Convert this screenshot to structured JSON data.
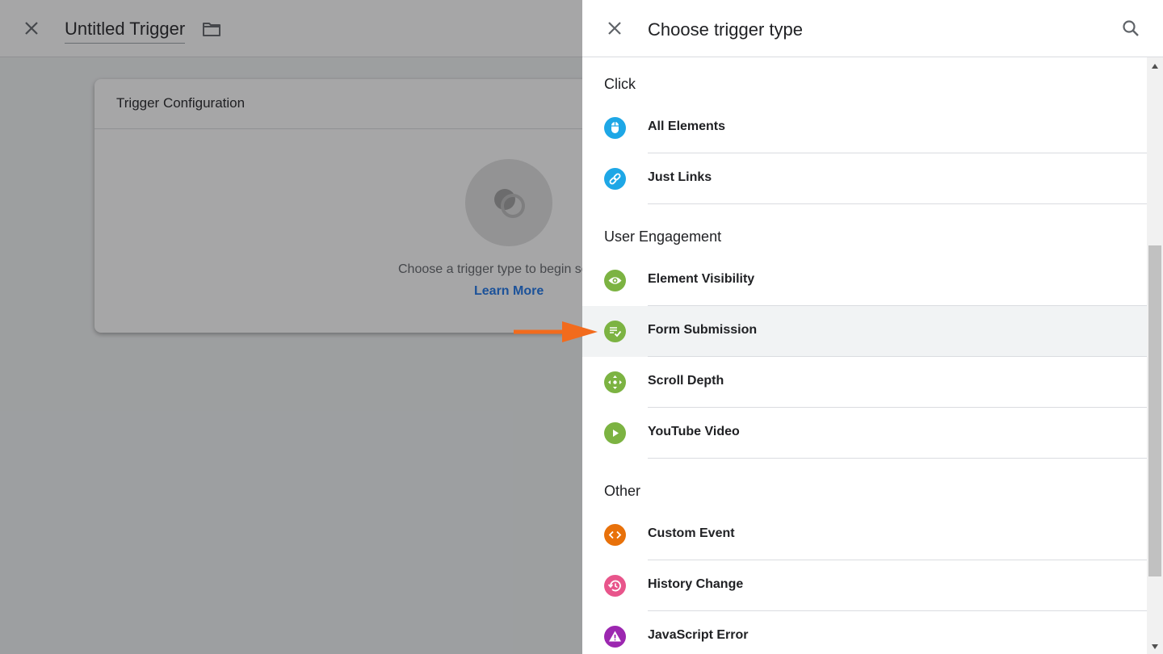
{
  "editor": {
    "trigger_name": "Untitled Trigger",
    "card_title": "Trigger Configuration",
    "empty_text": "Choose a trigger type to begin setup...",
    "learn_more": "Learn More"
  },
  "panel": {
    "title": "Choose trigger type",
    "groups": [
      {
        "label": "Click",
        "items": [
          {
            "label": "All Elements",
            "icon": "mouse-icon",
            "color": "#1ea7e6"
          },
          {
            "label": "Just Links",
            "icon": "link-icon",
            "color": "#1ea7e6"
          }
        ]
      },
      {
        "label": "User Engagement",
        "items": [
          {
            "label": "Element Visibility",
            "icon": "eye-icon",
            "color": "#7cb342"
          },
          {
            "label": "Form Submission",
            "icon": "form-check-icon",
            "color": "#7cb342"
          },
          {
            "label": "Scroll Depth",
            "icon": "move-arrows-icon",
            "color": "#7cb342"
          },
          {
            "label": "YouTube Video",
            "icon": "play-icon",
            "color": "#7cb342"
          }
        ]
      },
      {
        "label": "Other",
        "items": [
          {
            "label": "Custom Event",
            "icon": "code-icon",
            "color": "#e8710a"
          },
          {
            "label": "History Change",
            "icon": "history-icon",
            "color": "#e8558b"
          },
          {
            "label": "JavaScript Error",
            "icon": "warning-icon",
            "color": "#9c27b0"
          }
        ]
      }
    ],
    "highlighted_item": "Form Submission"
  }
}
